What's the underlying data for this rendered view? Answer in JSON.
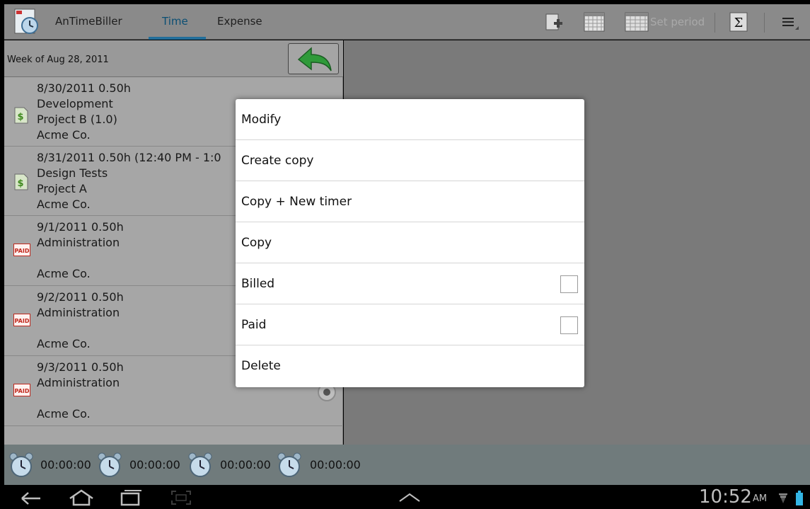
{
  "actionbar": {
    "app_title": "AnTimeBiller",
    "tabs": [
      {
        "label": "Time",
        "active": true
      },
      {
        "label": "Expense",
        "active": false
      }
    ],
    "set_period_label": "Set period",
    "accent_color": "#226e9a"
  },
  "list": {
    "week_label": "Week of Aug 28, 2011",
    "rows": [
      {
        "line1": "8/30/2011 0.50h",
        "line2": "Development",
        "line3": "Project B (1.0)",
        "line4": "Acme Co.",
        "status": "billed"
      },
      {
        "line1": "8/31/2011 0.50h (12:40 PM - 1:0",
        "line2": "Design Tests",
        "line3": "Project A",
        "line4": "Acme Co.",
        "status": "billed"
      },
      {
        "line1": "9/1/2011 0.50h",
        "line2": "Administration",
        "line3": "",
        "line4": "Acme Co.",
        "status": "paid"
      },
      {
        "line1": "9/2/2011 0.50h",
        "line2": "Administration",
        "line3": "",
        "line4": "Acme Co.",
        "status": "paid"
      },
      {
        "line1": "9/3/2011 0.50h",
        "line2": "Administration",
        "line3": "",
        "line4": "Acme Co.",
        "status": "paid"
      }
    ],
    "paid_badge": "PAID"
  },
  "timers": [
    "00:00:00",
    "00:00:00",
    "00:00:00",
    "00:00:00"
  ],
  "context_menu": {
    "items": [
      {
        "label": "Modify",
        "checkbox": false
      },
      {
        "label": "Create copy",
        "checkbox": false
      },
      {
        "label": "Copy + New timer",
        "checkbox": false
      },
      {
        "label": "Copy",
        "checkbox": false
      },
      {
        "label": "Billed",
        "checkbox": true,
        "checked": false
      },
      {
        "label": "Paid",
        "checkbox": true,
        "checked": false
      },
      {
        "label": "Delete",
        "checkbox": false
      }
    ]
  },
  "statusbar": {
    "time": "10:52",
    "ampm": "AM"
  }
}
